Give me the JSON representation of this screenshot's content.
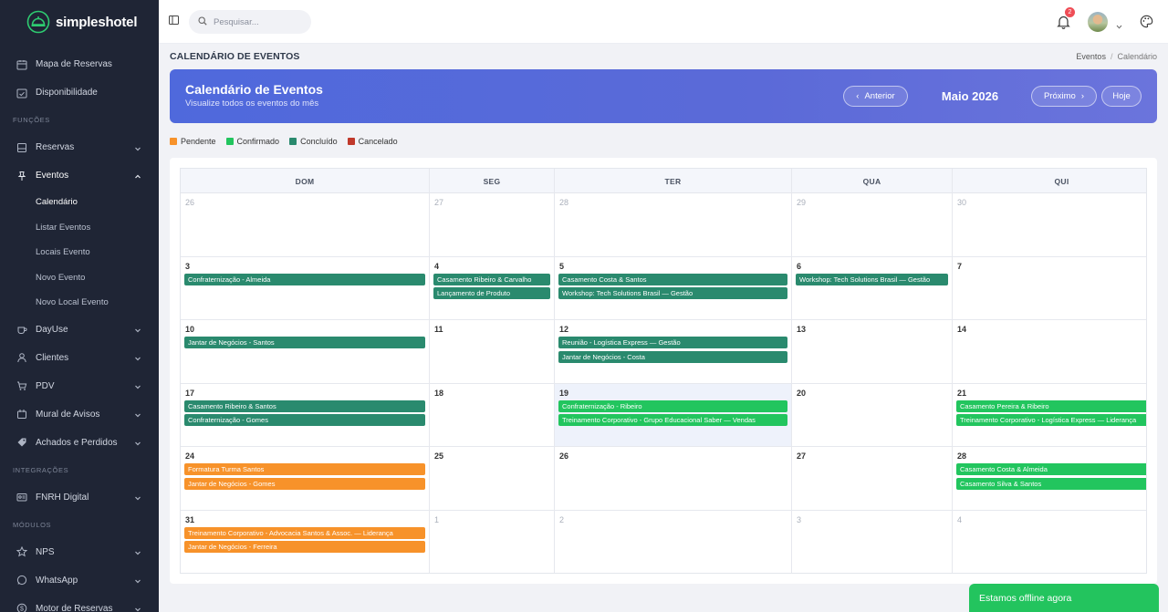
{
  "brand": {
    "name": "simpleshotel"
  },
  "sidebar": {
    "items_top": [
      {
        "label": "Mapa de Reservas",
        "icon": "map-icon"
      },
      {
        "label": "Disponibilidade",
        "icon": "calendar-check-icon"
      }
    ],
    "section_funcoes": "FUNÇÕES",
    "reservas": "Reservas",
    "eventos": "Eventos",
    "eventos_sub": [
      "Calendário",
      "Listar Eventos",
      "Locais Evento",
      "Novo Evento",
      "Novo Local Evento"
    ],
    "items_mid": [
      {
        "label": "DayUse",
        "icon": "coffee-icon"
      },
      {
        "label": "Clientes",
        "icon": "user-icon"
      },
      {
        "label": "PDV",
        "icon": "cart-icon"
      },
      {
        "label": "Mural de Avisos",
        "icon": "megaphone-icon"
      },
      {
        "label": "Achados e Perdidos",
        "icon": "tag-icon"
      }
    ],
    "section_integracoes": "INTEGRAÇÕES",
    "fnrh": "FNRH Digital",
    "section_modulos": "MÓDULOS",
    "items_bottom": [
      {
        "label": "NPS",
        "icon": "star-icon"
      },
      {
        "label": "WhatsApp",
        "icon": "whatsapp-icon"
      },
      {
        "label": "Motor de Reservas",
        "icon": "dollar-icon"
      }
    ]
  },
  "topbar": {
    "search_placeholder": "Pesquisar...",
    "notification_count": "2"
  },
  "page": {
    "title": "CALENDÁRIO DE EVENTOS",
    "breadcrumb": [
      "Eventos",
      "Calendário"
    ]
  },
  "banner": {
    "title": "Calendário de Eventos",
    "subtitle": "Visualize todos os eventos do mês",
    "prev_label": "Anterior",
    "month": "Maio 2026",
    "next_label": "Próximo",
    "today_label": "Hoje"
  },
  "legend": [
    {
      "label": "Pendente",
      "color": "#f7922a"
    },
    {
      "label": "Confirmado",
      "color": "#22c55e"
    },
    {
      "label": "Concluído",
      "color": "#2a8a6e"
    },
    {
      "label": "Cancelado",
      "color": "#c0392b"
    }
  ],
  "calendar": {
    "weekdays": [
      "DOM",
      "SEG",
      "TER",
      "QUA",
      "QUI"
    ],
    "weeks": [
      [
        {
          "day": "26",
          "other": true,
          "events": []
        },
        {
          "day": "27",
          "other": true,
          "events": []
        },
        {
          "day": "28",
          "other": true,
          "events": []
        },
        {
          "day": "29",
          "other": true,
          "events": []
        },
        {
          "day": "30",
          "other": true,
          "events": []
        }
      ],
      [
        {
          "day": "3",
          "events": [
            {
              "title": "Confraternização - Almeida",
              "status": "concluido"
            }
          ]
        },
        {
          "day": "4",
          "events": [
            {
              "title": "Casamento Ribeiro & Carvalho",
              "status": "concluido"
            },
            {
              "title": "Lançamento de Produto",
              "status": "concluido"
            }
          ]
        },
        {
          "day": "5",
          "events": [
            {
              "title": "Casamento Costa & Santos",
              "status": "concluido"
            },
            {
              "title": "Workshop: Tech Solutions Brasil — Gestão",
              "status": "concluido"
            }
          ]
        },
        {
          "day": "6",
          "events": [
            {
              "title": "Workshop: Tech Solutions Brasil — Gestão",
              "status": "concluido"
            }
          ]
        },
        {
          "day": "7",
          "events": []
        }
      ],
      [
        {
          "day": "10",
          "events": [
            {
              "title": "Jantar de Negócios - Santos",
              "status": "concluido"
            }
          ]
        },
        {
          "day": "11",
          "events": []
        },
        {
          "day": "12",
          "events": [
            {
              "title": "Reunião - Logística Express — Gestão",
              "status": "concluido"
            },
            {
              "title": "Jantar de Negócios - Costa",
              "status": "concluido"
            }
          ]
        },
        {
          "day": "13",
          "events": []
        },
        {
          "day": "14",
          "events": []
        }
      ],
      [
        {
          "day": "17",
          "events": [
            {
              "title": "Casamento Ribeiro & Santos",
              "status": "concluido"
            },
            {
              "title": "Confraternização - Gomes",
              "status": "concluido"
            }
          ]
        },
        {
          "day": "18",
          "events": []
        },
        {
          "day": "19",
          "today": true,
          "events": [
            {
              "title": "Confraternização - Ribeiro",
              "status": "confirmado"
            },
            {
              "title": "Treinamento Corporativo - Grupo Educacional Saber — Vendas",
              "status": "confirmado"
            }
          ]
        },
        {
          "day": "20",
          "events": []
        },
        {
          "day": "21",
          "events": [
            {
              "title": "Casamento Pereira & Ribeiro",
              "status": "confirmado"
            },
            {
              "title": "Treinamento Corporativo - Logística Express — Liderança",
              "status": "confirmado"
            }
          ]
        }
      ],
      [
        {
          "day": "24",
          "events": [
            {
              "title": "Formatura Turma Santos",
              "status": "pendente"
            },
            {
              "title": "Jantar de Negócios - Gomes",
              "status": "pendente"
            }
          ]
        },
        {
          "day": "25",
          "events": []
        },
        {
          "day": "26",
          "events": []
        },
        {
          "day": "27",
          "events": []
        },
        {
          "day": "28",
          "events": [
            {
              "title": "Casamento Costa & Almeida",
              "status": "confirmado"
            },
            {
              "title": "Casamento Silva & Santos",
              "status": "confirmado"
            }
          ]
        }
      ],
      [
        {
          "day": "31",
          "events": [
            {
              "title": "Treinamento Corporativo - Advocacia Santos & Assoc. — Liderança",
              "status": "pendente"
            },
            {
              "title": "Jantar de Negócios - Ferreira",
              "status": "pendente"
            }
          ]
        },
        {
          "day": "1",
          "other": true,
          "events": []
        },
        {
          "day": "2",
          "other": true,
          "events": []
        },
        {
          "day": "3",
          "other": true,
          "events": []
        },
        {
          "day": "4",
          "other": true,
          "events": []
        }
      ]
    ]
  },
  "status_colors": {
    "pendente": "#f7922a",
    "confirmado": "#22c55e",
    "concluido": "#2a8a6e",
    "cancelado": "#c0392b"
  },
  "chat": {
    "label": "Estamos offline agora"
  }
}
